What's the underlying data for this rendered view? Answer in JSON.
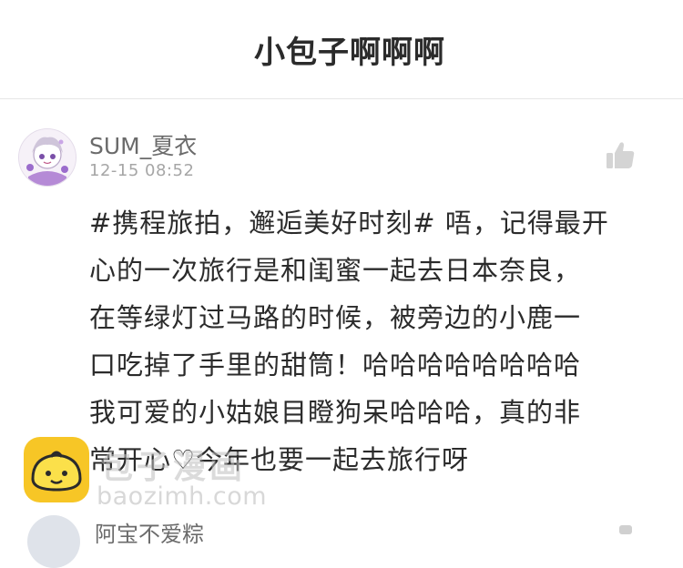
{
  "header": {
    "title": "小包子啊啊啊"
  },
  "comment": {
    "username": "SUM_夏衣",
    "timestamp": "12-15 08:52",
    "lines": [
      "#携程旅拍，邂逅美好时刻# 唔，记得最开",
      "心的一次旅行是和闺蜜一起去日本奈良，",
      "在等绿灯过马路的时候，被旁边的小鹿一",
      "口吃掉了手里的甜筒！哈哈哈哈哈哈哈哈",
      "我可爱的小姑娘目瞪狗呆哈哈哈，真的非",
      "常开心♡今年也要一起去旅行呀"
    ]
  },
  "next_comment": {
    "username": "阿宝不爱粽"
  },
  "watermark": {
    "name": "包子漫画",
    "url": "baozimh.com"
  },
  "icons": {
    "like": "thumbs-up-icon",
    "avatar": "avatar",
    "logo": "baozi-logo"
  },
  "colors": {
    "title": "#2b2b2b",
    "username": "#6b6b6b",
    "timestamp": "#a6a6a6",
    "like_icon": "#d4d4d4",
    "logo_bg": "#f7c626"
  }
}
